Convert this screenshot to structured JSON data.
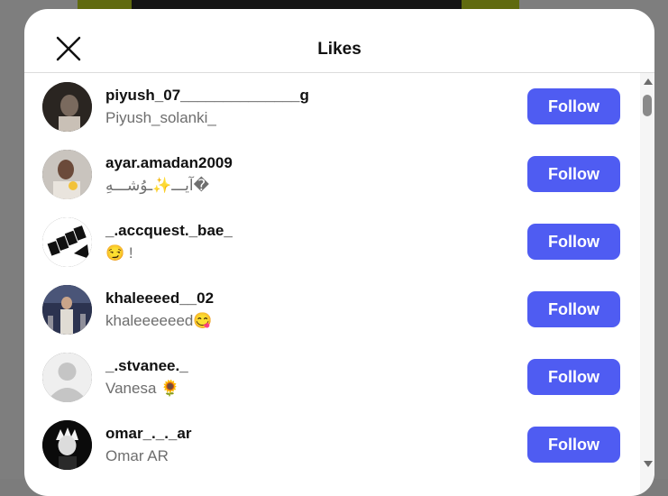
{
  "modal": {
    "title": "Likes",
    "follow_label": "Follow"
  },
  "users": [
    {
      "username": "piyush_07______________g",
      "fullname": "Piyush_solanki_"
    },
    {
      "username": "ayar.amadan2009",
      "fullname": "آيـــ✨ـوُشـــهِ�"
    },
    {
      "username": "_.accquest._bae_",
      "fullname": "😏 !"
    },
    {
      "username": "khaleeeed__02",
      "fullname": "khaleeeeeed😋"
    },
    {
      "username": "_.stvanee._",
      "fullname": "Vanesa 🌻"
    },
    {
      "username": "omar_._._ar",
      "fullname": "Omar AR"
    }
  ],
  "colors": {
    "follow_button": "#4f5cf2",
    "modal_bg": "#ffffff"
  }
}
